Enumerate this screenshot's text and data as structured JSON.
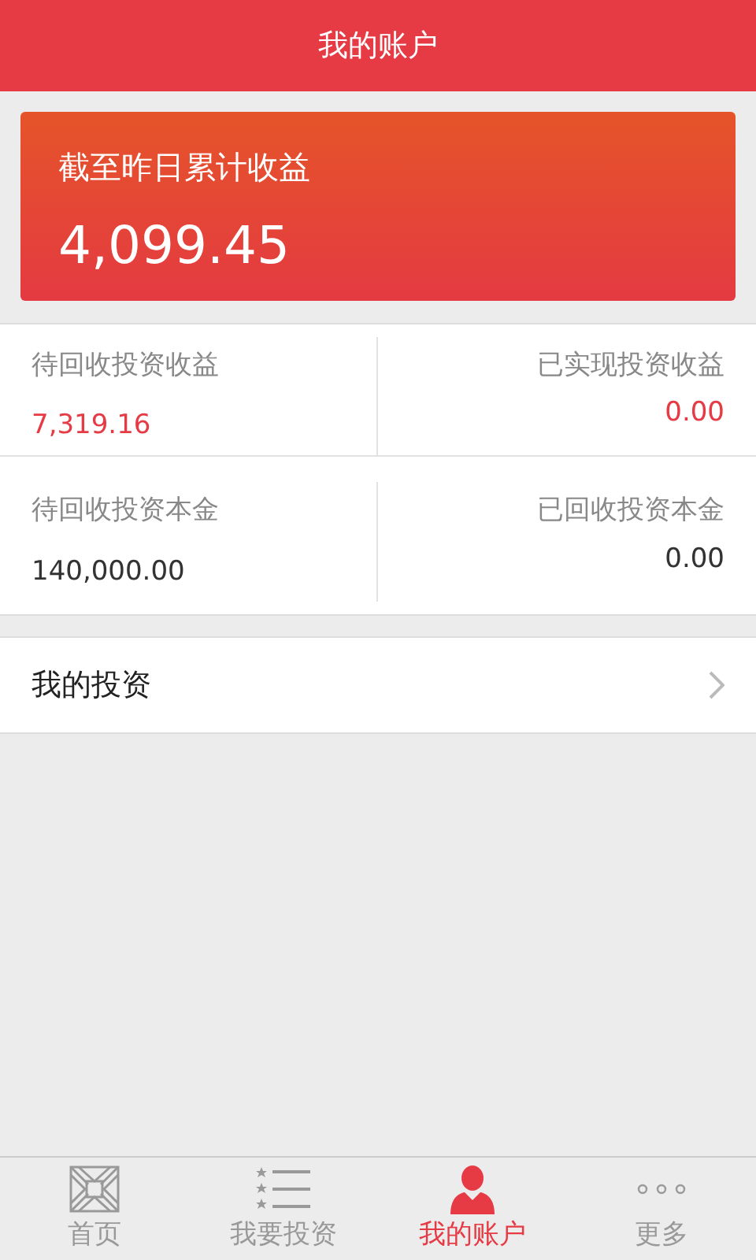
{
  "header": {
    "title": "我的账户"
  },
  "summary": {
    "label": "截至昨日累计收益",
    "value": "4,099.45"
  },
  "stats": [
    {
      "label": "待回收投资收益",
      "value": "7,319.16",
      "highlighted": true
    },
    {
      "label": "已实现投资收益",
      "value": "0.00",
      "highlighted": true
    },
    {
      "label": "待回收投资本金",
      "value": "140,000.00",
      "highlighted": false
    },
    {
      "label": "已回收投资本金",
      "value": "0.00",
      "highlighted": false
    }
  ],
  "menu": [
    {
      "label": "我的投资"
    }
  ],
  "tabs": [
    {
      "label": "首页",
      "kind": "home",
      "selected": false
    },
    {
      "label": "我要投资",
      "kind": "list",
      "selected": false
    },
    {
      "label": "我的账户",
      "kind": "account",
      "selected": true
    },
    {
      "label": "更多",
      "kind": "more",
      "selected": false
    }
  ]
}
